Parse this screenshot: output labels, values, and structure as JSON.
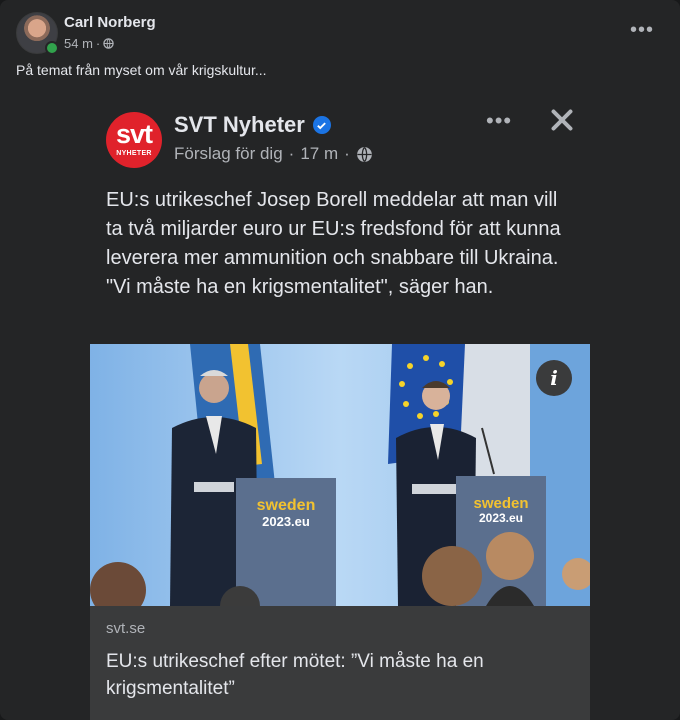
{
  "post": {
    "author": "Carl Norberg",
    "time": "54 m",
    "separator": "·",
    "text": "På temat från myset om vår krigskultur...",
    "menu_icon": "more-horizontal-icon",
    "privacy_icon": "globe-icon"
  },
  "shared": {
    "logo_text": "svt",
    "logo_sub": "NYHETER",
    "page_name": "SVT Nyheter",
    "sub_label": "Förslag för dig",
    "separator": "·",
    "time": "17 m",
    "text": "EU:s utrikeschef Josep Borell meddelar att man vill ta två miljarder euro ur EU:s fredsfond för att kunna leverera mer ammunition och snabbare till Ukraina. \"Vi måste ha en krigsmentalitet\", säger han.",
    "image": {
      "podium_left": [
        "sweden",
        "2023.eu"
      ],
      "podium_right": [
        "sweden",
        "2023.eu"
      ]
    },
    "link": {
      "domain": "svt.se",
      "title": "EU:s utrikeschef efter mötet: ”Vi måste ha en krigsmentalitet”"
    }
  },
  "colors": {
    "background": "#242526",
    "svt_red": "#e0222b",
    "verified_blue": "#1b74e4",
    "text_primary": "#e4e6eb",
    "text_secondary": "#b0b3b8"
  }
}
